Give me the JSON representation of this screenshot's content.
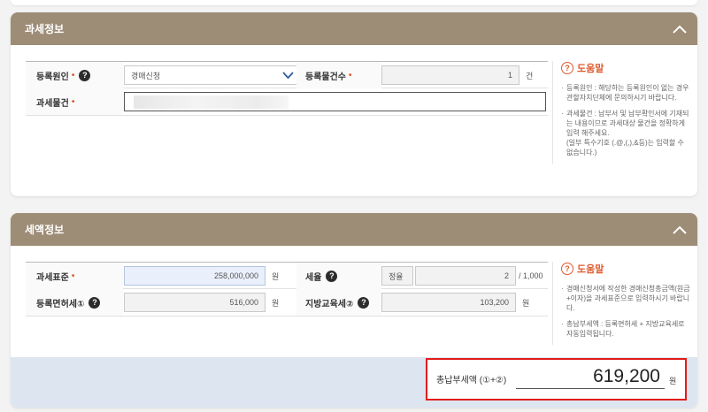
{
  "tax_info": {
    "title": "과세정보",
    "reg_cause_label": "등록원인",
    "req_mark": "•",
    "help_q": "?",
    "reg_cause_value": "경매신청",
    "reg_count_label": "등록물건수",
    "reg_count_value": "1",
    "reg_count_unit": "건",
    "tax_object_label": "과세물건",
    "help": {
      "title": "도움말",
      "icon_char": "?",
      "items": [
        "등록원인 : 해당하는 등록원인이 없는 경우 관할자치단체에 문의하시기 바랍니다.",
        "과세물건 : 납부서 및 납부확인서에 기재되는 내용이므로 과세대상 물건을 정확하게 입력 해주세요.\n(일부 특수기호 (.@,(,),&등)는 입력할 수 없습니다.)"
      ]
    }
  },
  "tax_amount": {
    "title": "세액정보",
    "tax_base_label": "과세표준",
    "tax_base_value": "258,000,000",
    "won": "원",
    "tax_rate_label": "세율",
    "rate_type": "정율",
    "rate_value": "2",
    "rate_unit": "/ 1,000",
    "reg_license_tax_label": "등록면허세①",
    "reg_license_tax_value": "516,000",
    "local_edu_tax_label": "지방교육세②",
    "local_edu_tax_value": "103,200",
    "help": {
      "title": "도움말",
      "icon_char": "?",
      "items": [
        "경매신청서에 작성한 경매신청총금액(원금+이자)을 과세표준으로 입력하시기 바랍니다.",
        "총납부세액 : 등록면허세 + 지방교육세로 자동입력됩니다."
      ]
    },
    "total_label": "총납부세액 (①+②)",
    "total_value": "619,200",
    "total_unit": "원"
  },
  "colors": {
    "header": "#9d8c76",
    "required": "#e05a2d",
    "total_border": "#e21c1c",
    "total_bar": "#dde6f0"
  }
}
